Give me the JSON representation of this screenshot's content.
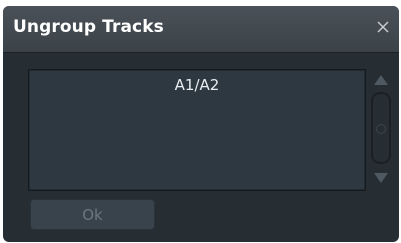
{
  "dialog": {
    "title": "Ungroup Tracks",
    "close_icon": "close-icon",
    "list": {
      "items": [
        "A1/A2"
      ]
    },
    "scrollbar": {
      "up_icon": "triangle-up-icon",
      "down_icon": "triangle-down-icon"
    },
    "ok_label": "Ok",
    "ok_enabled": false
  },
  "colors": {
    "background": "#262d33",
    "titlebar": "#42494f",
    "list_background": "#2e3840",
    "text": "#ffffff",
    "disabled_text": "#6c767e",
    "button": "#39434c"
  }
}
